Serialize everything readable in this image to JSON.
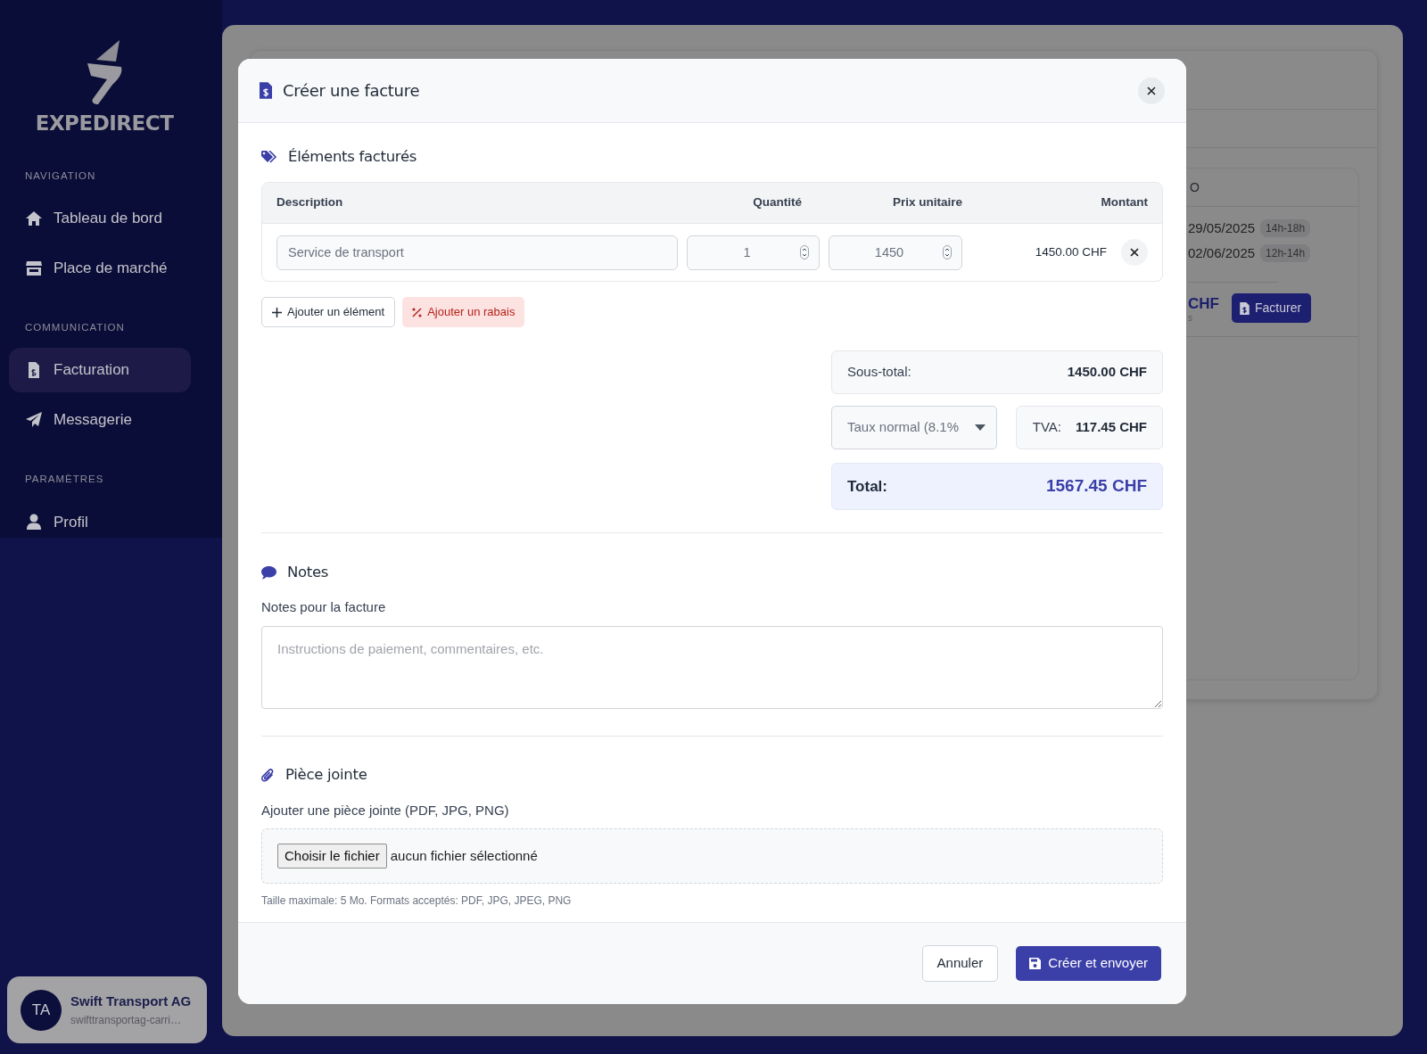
{
  "sidebar": {
    "logo_text": "EXPEDIRECT",
    "sections": [
      {
        "title": "NAVIGATION",
        "items": [
          {
            "label": "Tableau de bord",
            "selected": false
          },
          {
            "label": "Place de marché",
            "selected": false
          }
        ]
      },
      {
        "title": "COMMUNICATION",
        "items": [
          {
            "label": "Facturation",
            "selected": true
          },
          {
            "label": "Messagerie",
            "selected": false
          }
        ]
      },
      {
        "title": "PARAMÈTRES",
        "items": [
          {
            "label": "Profil",
            "selected": false
          }
        ]
      }
    ],
    "user": {
      "initials": "TA",
      "name": "Swift Transport AG",
      "email": "swifttransportag-carri…"
    }
  },
  "background": {
    "card_header": "O",
    "dates": [
      {
        "date": "29/05/2025",
        "time": "14h-18h"
      },
      {
        "date": "02/06/2025",
        "time": "12h-14h"
      }
    ],
    "price": "CHF",
    "price_note": "s",
    "button": "Facturer"
  },
  "modal": {
    "title": "Créer une facture",
    "items_section": {
      "heading": "Éléments facturés",
      "columns": [
        "Description",
        "Quantité",
        "Prix unitaire",
        "Montant"
      ],
      "rows": [
        {
          "description": "Service de transport",
          "quantity": "1",
          "unit_price": "1450",
          "amount": "1450.00 CHF"
        }
      ],
      "add_item": "Ajouter un élément",
      "add_discount": "Ajouter un rabais"
    },
    "totals": {
      "subtotal_label": "Sous-total:",
      "subtotal": "1450.00 CHF",
      "vat_rate": "Taux normal (8.1%",
      "vat_label": "TVA:",
      "vat": "117.45 CHF",
      "total_label": "Total:",
      "total": "1567.45 CHF"
    },
    "notes": {
      "heading": "Notes",
      "label": "Notes pour la facture",
      "placeholder": "Instructions de paiement, commentaires, etc."
    },
    "attachment": {
      "heading": "Pièce jointe",
      "label": "Ajouter une pièce jointe (PDF, JPG, PNG)",
      "choose_button": "Choisir le fichier",
      "file_status": "aucun fichier sélectionné",
      "help": "Taille maximale: 5 Mo. Formats acceptés: PDF, JPG, JPEG, PNG"
    },
    "footer": {
      "cancel": "Annuler",
      "submit": "Créer et envoyer"
    }
  }
}
